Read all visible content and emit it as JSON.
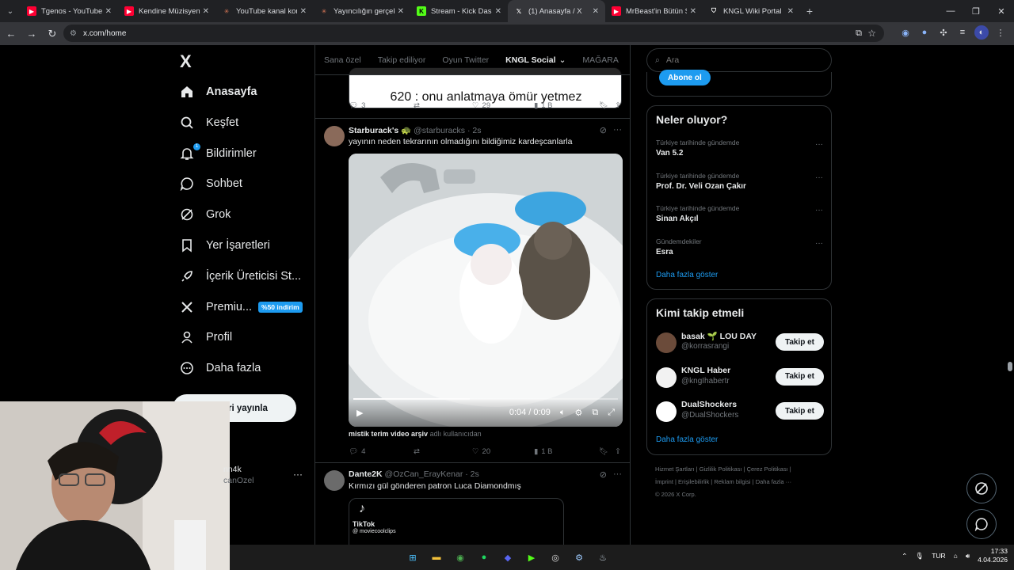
{
  "browser": {
    "tabs": [
      {
        "title": "Tgenos - YouTube",
        "icon": "youtube-icon",
        "color": "#ff0033"
      },
      {
        "title": "Kendine Müzisyen - YouTube",
        "icon": "youtube-icon",
        "color": "#ff0033"
      },
      {
        "title": "YouTube kanal konum",
        "icon": "asterisk-icon",
        "color": "#d97757"
      },
      {
        "title": "Yayıncılığın gerçek h",
        "icon": "asterisk-icon",
        "color": "#d97757"
      },
      {
        "title": "Stream - Kick Dashbo",
        "icon": "kick-icon",
        "color": "#53fc18"
      },
      {
        "title": "(1) Anasayfa / X",
        "icon": "x-icon",
        "color": "#ffffff"
      },
      {
        "title": "MrBeast'in Bütün Stü",
        "icon": "youtube-icon",
        "color": "#ff0033"
      },
      {
        "title": "KNGL Wiki Portal",
        "icon": "shield-icon",
        "color": "#ffffff"
      }
    ],
    "active_tab": 5,
    "url": "x.com/home"
  },
  "nav": {
    "logo": "X",
    "items": [
      {
        "label": "Anasayfa",
        "icon": "home-icon"
      },
      {
        "label": "Keşfet",
        "icon": "search-icon"
      },
      {
        "label": "Bildirimler",
        "icon": "bell-icon",
        "badge": "1"
      },
      {
        "label": "Sohbet",
        "icon": "chat-icon"
      },
      {
        "label": "Grok",
        "icon": "grok-icon"
      },
      {
        "label": "Yer İşaretleri",
        "icon": "bookmark-icon"
      },
      {
        "label": "İçerik Üreticisi St...",
        "icon": "rocket-icon"
      },
      {
        "label": "Premiu...",
        "icon": "x-icon",
        "discount": "%50 indirim"
      },
      {
        "label": "Profil",
        "icon": "person-icon"
      },
      {
        "label": "Daha fazla",
        "icon": "more-circle-icon"
      }
    ],
    "post_button": "ri yayınla",
    "account_name": "nn4k",
    "account_handle": "canOzel"
  },
  "feed": {
    "tabs": [
      "Sana özel",
      "Takip ediliyor",
      "Oyun Twitter",
      "KNGL Social",
      "MAĞARA"
    ],
    "active_tab": "KNGL Social",
    "prev_post": {
      "quote_text": "620 : onu anlatmaya ömür yetmez",
      "replies": "3",
      "reposts": "",
      "likes": "29",
      "views": "1 B"
    },
    "post1": {
      "name": "Starburack's 🐢",
      "handle": "@starburacks",
      "time": "· 2s",
      "text": "yayının neden tekrarının olmadığını bildiğimiz kardeşcanlarla",
      "video_time": "0:04 / 0:09",
      "video_progress": 0.44,
      "source_name": "mistik terim video arşiv",
      "source_suffix": "adlı kullanıcıdan",
      "replies": "4",
      "reposts": "",
      "likes": "20",
      "views": "1 B"
    },
    "post2": {
      "name": "Dante2K",
      "handle": "@OzCan_ErayKenar",
      "time": "· 2s",
      "text": "Kırmızı gül gönderen patron Luca Diamondmış",
      "tiktok_label": "TikTok",
      "tiktok_handle": "@ moviecoolclips"
    }
  },
  "sidebar": {
    "search_placeholder": "Ara",
    "subscribe_button": "Abone ol",
    "trends_title": "Neler oluyor?",
    "trends": [
      {
        "category": "Türkiye tarihinde gündemde",
        "name": "Van 5.2"
      },
      {
        "category": "Türkiye tarihinde gündemde",
        "name": "Prof. Dr. Veli Ozan Çakır"
      },
      {
        "category": "Türkiye tarihinde gündemde",
        "name": "Sinan Akçıl"
      },
      {
        "category": "Gündemdekiler",
        "name": "Esra"
      }
    ],
    "trends_more": "Daha fazla göster",
    "follow_title": "Kimi takip etmeli",
    "follow": [
      {
        "name": "basak 🌱 LOU DAY",
        "handle": "@korrasrangi",
        "button": "Takip et"
      },
      {
        "name": "KNGL Haber",
        "handle": "@kngIhabertr",
        "button": "Takip et"
      },
      {
        "name": "DualShockers",
        "handle": "@DualShockers",
        "button": "Takip et"
      }
    ],
    "follow_more": "Daha fazla göster",
    "footer_line1": "Hizmet Şartları  |  Gizlilik Politikası  |  Çerez Politikası  |",
    "footer_line2": "İmprint  |  Erişilebilirlik  |  Reklam bilgisi  |  Daha fazla ···",
    "footer_line3": "© 2026 X Corp."
  },
  "taskbar": {
    "lang": "TUR",
    "time": "17:33",
    "date": "4.04.2026"
  }
}
